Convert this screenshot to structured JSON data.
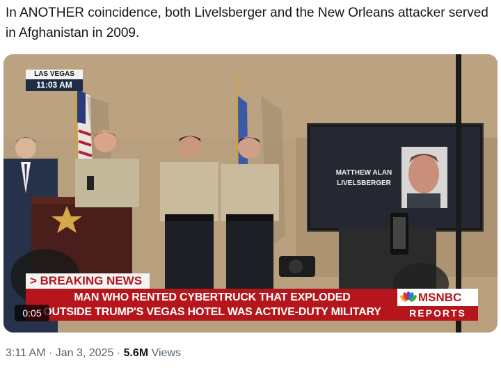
{
  "tweet": {
    "text": "In ANOTHER coincidence, both Livelsberger and the New Orleans attacker served in Afghanistan in 2009."
  },
  "video": {
    "location": "LAS VEGAS",
    "time": "11:03 AM",
    "screen_name_line1": "MATTHEW ALAN",
    "screen_name_line2": "LIVELSBERGER",
    "breaking_label": "> BREAKING NEWS",
    "headline_line1": "MAN WHO RENTED CYBERTRUCK THAT EXPLODED",
    "headline_line2": "OUTSIDE TRUMP'S VEGAS HOTEL WAS ACTIVE-DUTY MILITARY",
    "network": "MSNBC",
    "network_sub": "REPORTS",
    "timer": "0:05"
  },
  "meta": {
    "time": "3:11 AM",
    "separator": " · ",
    "date": "Jan 3, 2025",
    "views_count": "5.6M",
    "views_label": " Views"
  },
  "colors": {
    "breaking_red": "#b5161c",
    "wall": "#b89f7d",
    "meta_gray": "#536471"
  }
}
